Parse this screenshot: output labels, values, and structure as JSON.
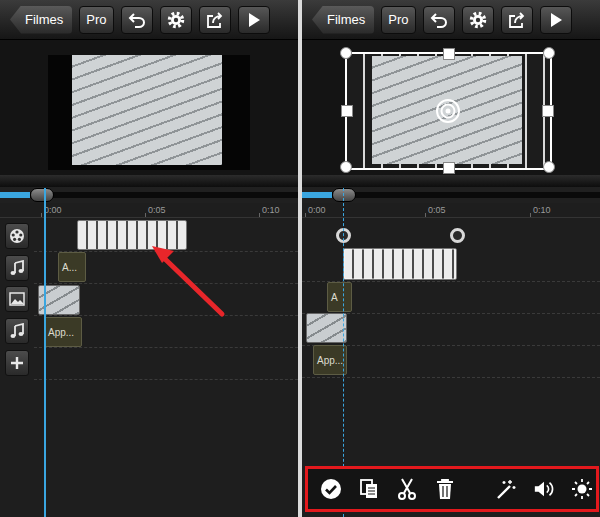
{
  "panels": [
    {
      "back_button": "Filmes",
      "pro_button": "Pro",
      "frame_selected": false,
      "scrubber": {
        "level": 0.1
      },
      "ruler": [
        "0:00",
        "0:05",
        "0:10"
      ],
      "tracks": [
        {
          "kind": "video"
        },
        {
          "kind": "audio"
        },
        {
          "kind": "image"
        },
        {
          "kind": "audio"
        },
        {
          "kind": "add"
        }
      ],
      "clips": [
        {
          "kind": "video",
          "selected": false
        },
        {
          "kind": "audio",
          "label": "A...",
          "selected": false
        },
        {
          "kind": "image",
          "selected": false
        },
        {
          "kind": "audio",
          "label": "App...",
          "selected": false
        }
      ],
      "toolbar_visible": false
    },
    {
      "back_button": "Filmes",
      "pro_button": "Pro",
      "frame_selected": true,
      "scrubber": {
        "level": 0.1
      },
      "ruler": [
        "0:00",
        "0:05",
        "0:10"
      ],
      "tracks": [],
      "clips": [
        {
          "kind": "video",
          "selected": true
        },
        {
          "kind": "audio",
          "label": "A",
          "selected": false
        },
        {
          "kind": "image",
          "selected": false
        },
        {
          "kind": "audio",
          "label": "App...",
          "selected": false
        }
      ],
      "toolbar_visible": true
    }
  ],
  "annotations": {
    "arrow": true,
    "toolbar_box": true
  }
}
